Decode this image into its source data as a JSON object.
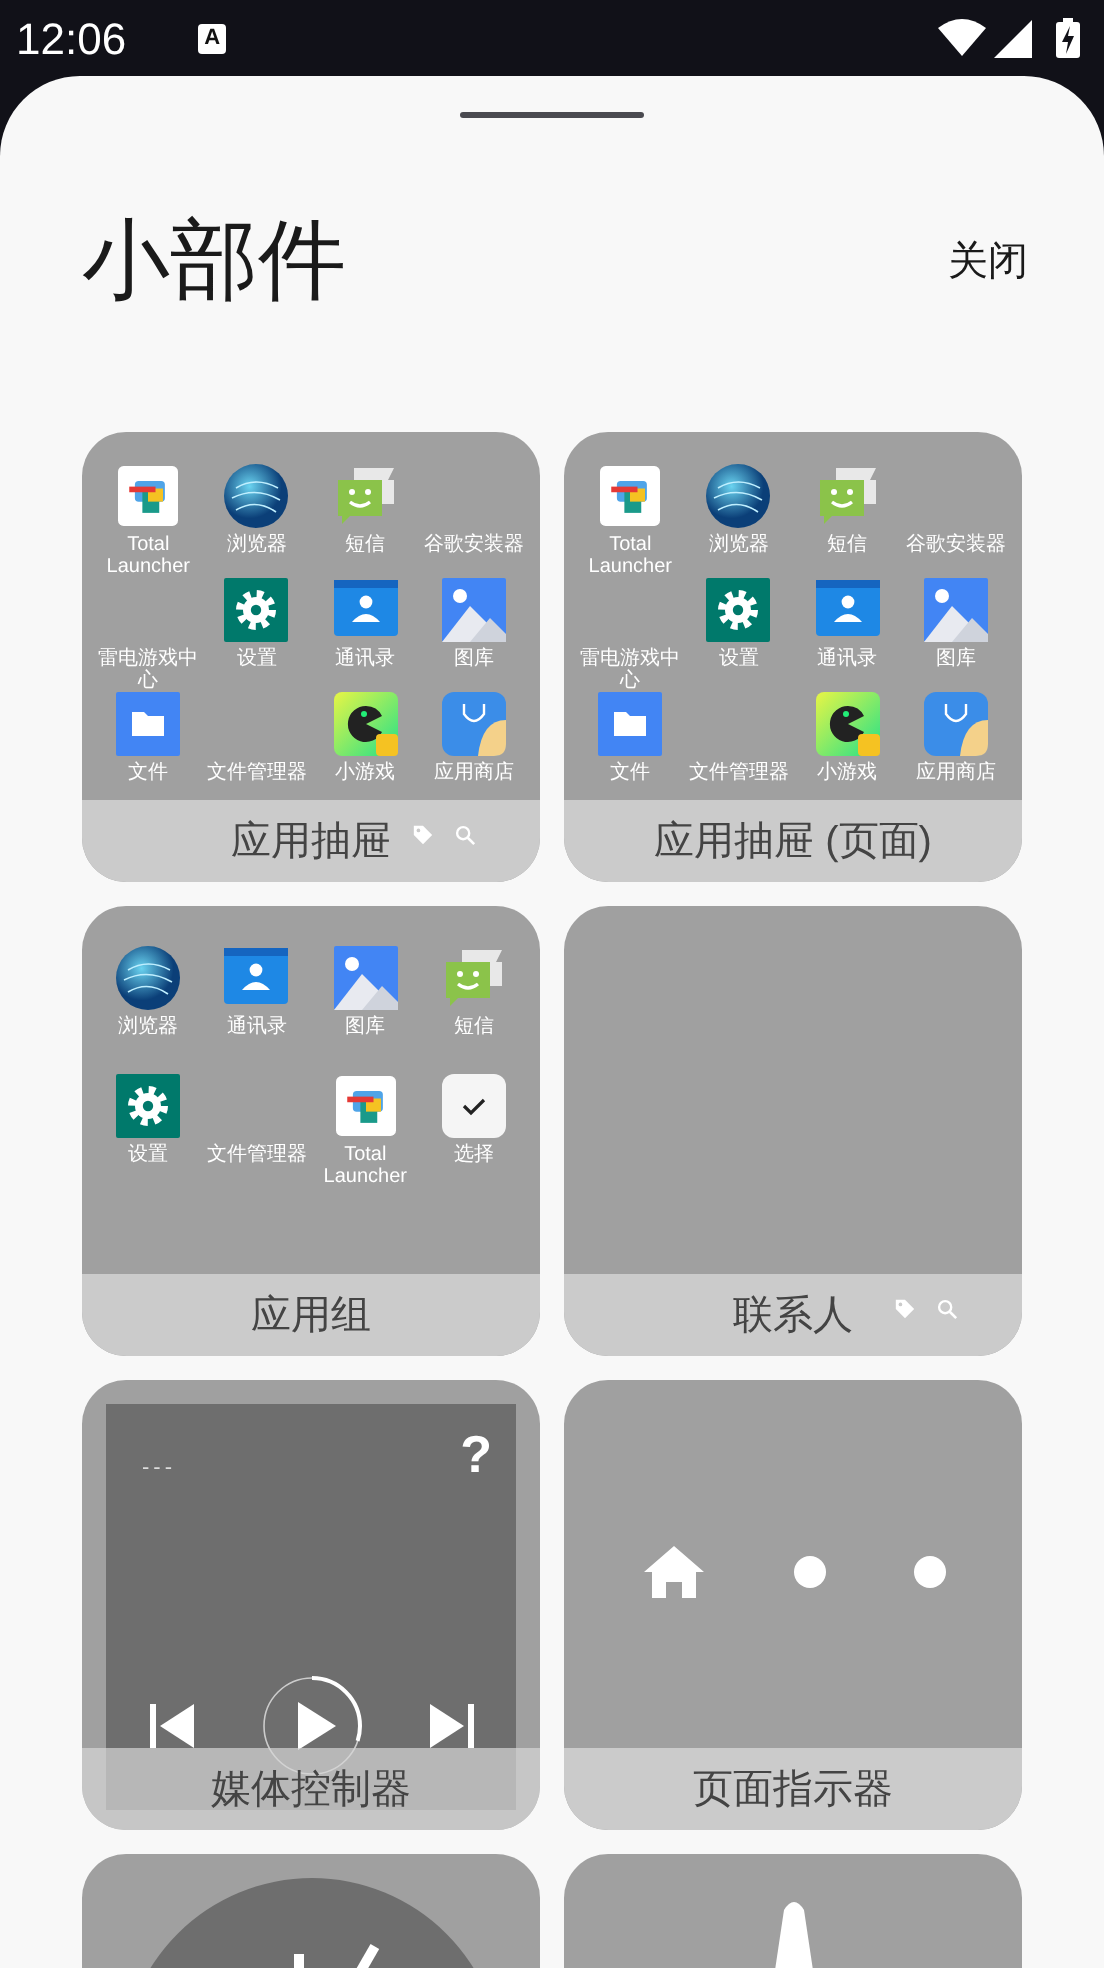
{
  "status_bar": {
    "time": "12:06",
    "notification_icon": "A"
  },
  "sheet": {
    "title": "小部件",
    "close_button": "关闭"
  },
  "widgets": [
    {
      "kind": "app_drawer",
      "label": "应用抽屉",
      "apps": [
        {
          "label": "Total Launcher",
          "kind": "total_launcher"
        },
        {
          "label": "浏览器",
          "kind": "browser"
        },
        {
          "label": "短信",
          "kind": "sms"
        },
        {
          "label": "谷歌安装器",
          "kind": "none"
        },
        {
          "label": "雷电游戏中心",
          "kind": "none"
        },
        {
          "label": "设置",
          "kind": "settings"
        },
        {
          "label": "通讯录",
          "kind": "contacts"
        },
        {
          "label": "图库",
          "kind": "gallery"
        },
        {
          "label": "文件",
          "kind": "files"
        },
        {
          "label": "文件管理器",
          "kind": "none"
        },
        {
          "label": "小游戏",
          "kind": "game"
        },
        {
          "label": "应用商店",
          "kind": "store"
        }
      ]
    },
    {
      "kind": "app_drawer_paged",
      "label": "应用抽屉 (页面)",
      "apps": [
        {
          "label": "Total Launcher",
          "kind": "total_launcher"
        },
        {
          "label": "浏览器",
          "kind": "browser"
        },
        {
          "label": "短信",
          "kind": "sms"
        },
        {
          "label": "谷歌安装器",
          "kind": "none"
        },
        {
          "label": "雷电游戏中心",
          "kind": "none"
        },
        {
          "label": "设置",
          "kind": "settings"
        },
        {
          "label": "通讯录",
          "kind": "contacts"
        },
        {
          "label": "图库",
          "kind": "gallery"
        },
        {
          "label": "文件",
          "kind": "files"
        },
        {
          "label": "文件管理器",
          "kind": "none"
        },
        {
          "label": "小游戏",
          "kind": "game"
        },
        {
          "label": "应用商店",
          "kind": "store"
        }
      ]
    },
    {
      "kind": "app_group",
      "label": "应用组",
      "apps": [
        {
          "label": "浏览器",
          "kind": "browser"
        },
        {
          "label": "通讯录",
          "kind": "contacts"
        },
        {
          "label": "图库",
          "kind": "gallery"
        },
        {
          "label": "短信",
          "kind": "sms"
        },
        {
          "label": "设置",
          "kind": "settings"
        },
        {
          "label": "文件管理器",
          "kind": "none"
        },
        {
          "label": "Total Launcher",
          "kind": "total_launcher"
        },
        {
          "label": "选择",
          "kind": "check"
        }
      ]
    },
    {
      "kind": "contacts",
      "label": "联系人"
    },
    {
      "kind": "media",
      "label": "媒体控制器",
      "title": "---",
      "art": "?",
      "level": 0.3
    },
    {
      "kind": "page_indicator",
      "label": "页面指示器",
      "pages": [
        {
          "kind": "home"
        },
        {
          "kind": "dot"
        },
        {
          "kind": "dot"
        }
      ]
    },
    {
      "kind": "clock"
    },
    {
      "kind": "pointer"
    }
  ]
}
